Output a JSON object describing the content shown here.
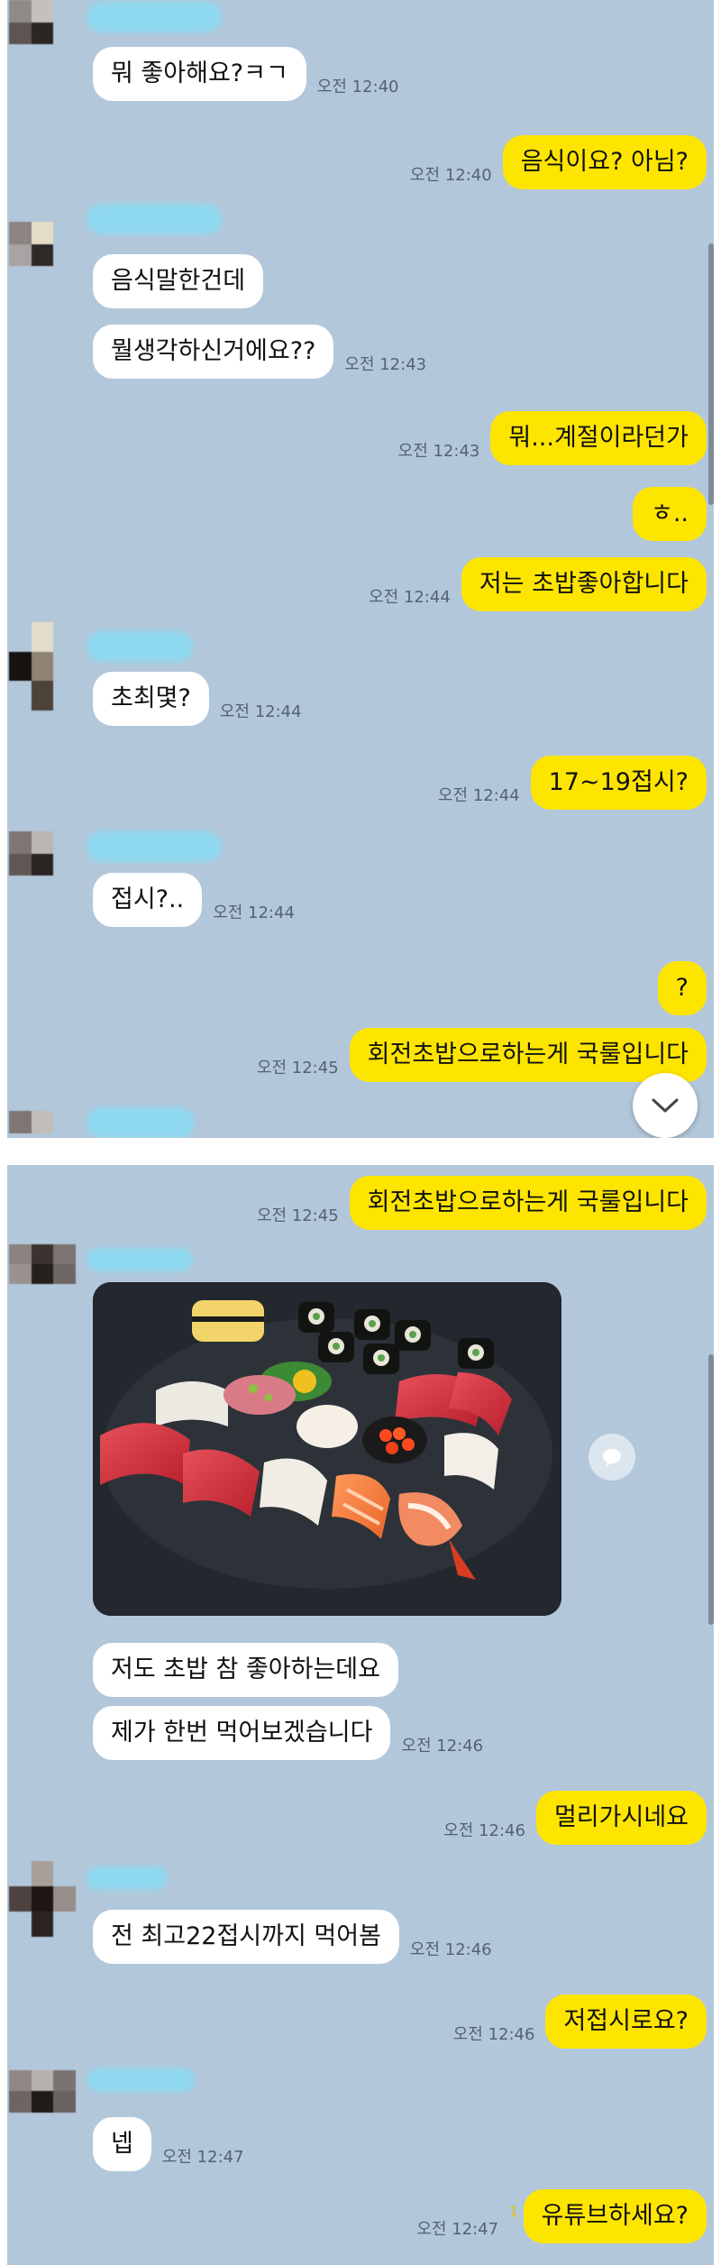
{
  "panel1": {
    "messages": [
      {
        "side": "in",
        "text": "뭐 좋아해요?ㅋㄱ",
        "time": "오전 12:40"
      },
      {
        "side": "out",
        "text": "음식이요? 아님?",
        "time": "오전 12:40"
      },
      {
        "side": "in",
        "text": "음식말한건데",
        "time": ""
      },
      {
        "side": "in",
        "text": "뭘생각하신거에요??",
        "time": "오전 12:43"
      },
      {
        "side": "out",
        "text": "뭐...계절이라던가",
        "time": "오전 12:43"
      },
      {
        "side": "out",
        "text": "ㅎ..",
        "time": ""
      },
      {
        "side": "out",
        "text": "저는 초밥좋아합니다",
        "time": "오전 12:44"
      },
      {
        "side": "in",
        "text": "초최몇?",
        "time": "오전 12:44"
      },
      {
        "side": "out",
        "text": "17~19접시?",
        "time": "오전 12:44"
      },
      {
        "side": "in",
        "text": "접시?..",
        "time": "오전 12:44"
      },
      {
        "side": "out",
        "text": "?",
        "time": ""
      },
      {
        "side": "out",
        "text": "회전초밥으로하는게 국룰입니다",
        "time": "오전 12:45"
      }
    ]
  },
  "panel2": {
    "messages": [
      {
        "side": "out",
        "text": "회전초밥으로하는게 국룰입니다",
        "time": "오전 12:45"
      },
      {
        "side": "in",
        "text": "저도 초밥 참 좋아하는데요",
        "time": ""
      },
      {
        "side": "in",
        "text": "제가 한번 먹어보겠습니다",
        "time": "오전 12:46"
      },
      {
        "side": "out",
        "text": "멀리가시네요",
        "time": "오전 12:46"
      },
      {
        "side": "in",
        "text": "전 최고22접시까지 먹어봄",
        "time": "오전 12:46"
      },
      {
        "side": "out",
        "text": "저접시로요?",
        "time": "오전 12:46"
      },
      {
        "side": "in",
        "text": "넵",
        "time": "오전 12:47"
      },
      {
        "side": "out",
        "text": "유튜브하세요?",
        "time": "오전 12:47",
        "unread": "1"
      }
    ]
  },
  "icons": {
    "scroll_down": "chevron-down-icon",
    "share": "speech-bubble-icon"
  },
  "colors": {
    "chat_background": "#b2c7da",
    "outgoing_bubble": "#fee500",
    "incoming_bubble": "#ffffff"
  }
}
